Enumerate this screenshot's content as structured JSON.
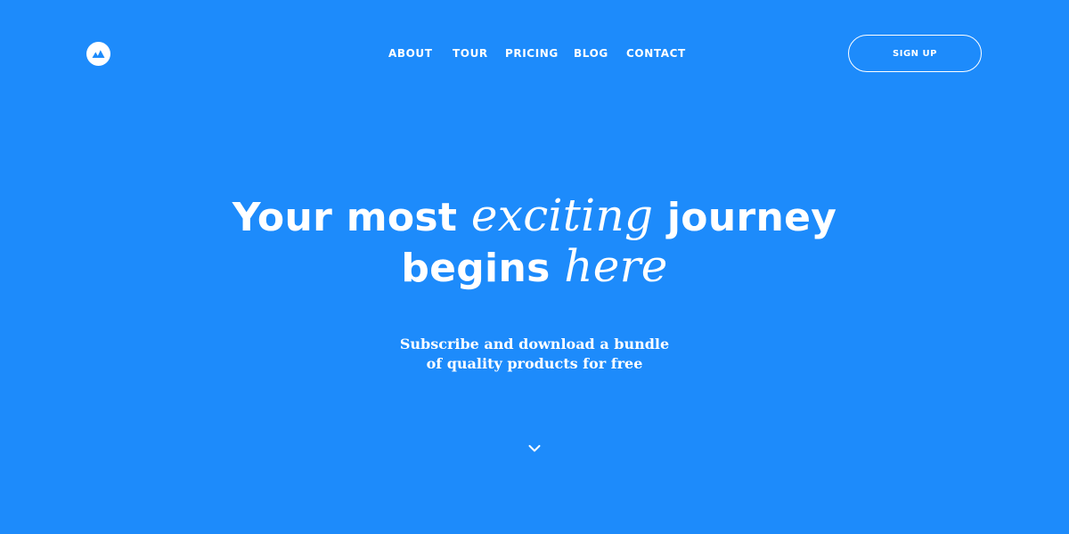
{
  "brand": {
    "logo_icon": "mountain-logo-icon"
  },
  "nav": {
    "items": [
      {
        "label": "ABOUT"
      },
      {
        "label": "TOUR"
      },
      {
        "label": "PRICING"
      },
      {
        "label": "BLOG"
      },
      {
        "label": "CONTACT"
      }
    ]
  },
  "header": {
    "signup_label": "SIGN UP"
  },
  "hero": {
    "heading": {
      "part1": "Your most ",
      "part2_italic": "exciting",
      "part3": " journey",
      "part4": "begins ",
      "part5_italic": "here"
    },
    "subtitle": {
      "line1": "Subscribe and download a bundle",
      "line2": "of quality products for free"
    },
    "scroll_icon": "chevron-down-icon"
  },
  "colors": {
    "background": "#1d8bfb",
    "text": "#ffffff"
  }
}
